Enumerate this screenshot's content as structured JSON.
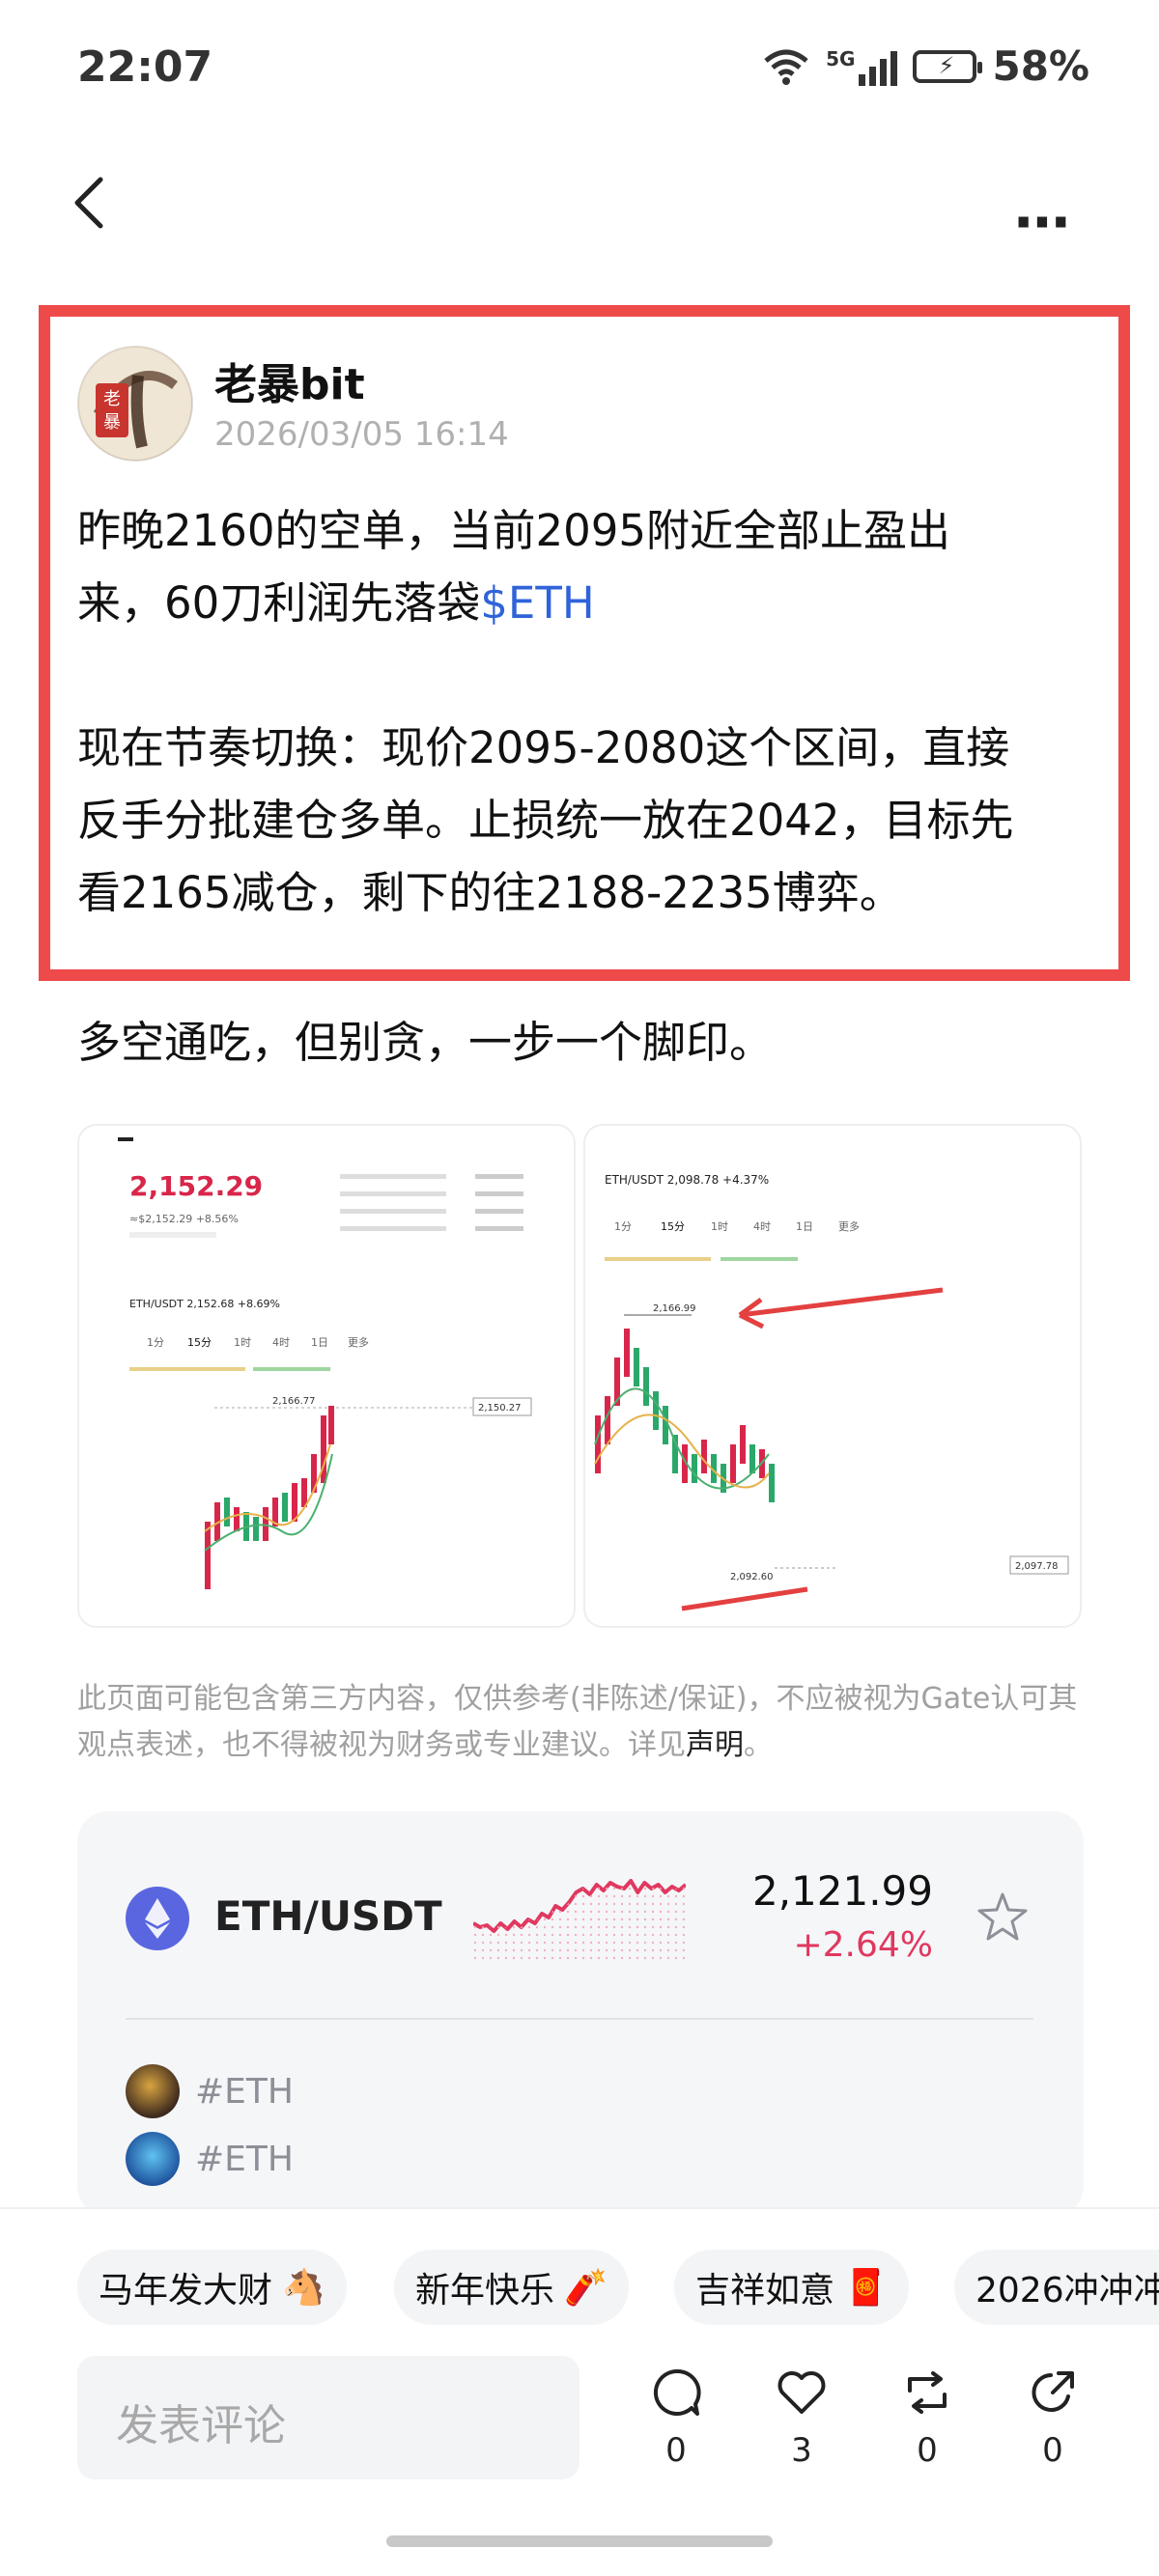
{
  "status": {
    "time": "22:07",
    "network": "5G",
    "battery": "58%"
  },
  "post": {
    "author": "老暴bit",
    "avatar_text": "老暴",
    "date": "2026/03/05 16:14",
    "line1": "昨晚2160的空单，当前2095附近全部止盈出",
    "line2_pre": "来，60刀利润先落袋",
    "line2_tag": "$ETH",
    "line3": "现在节奏切换：现价2095-2080这个区间，直接",
    "line4": "反手分批建仓多单。止损统一放在2042，目标先",
    "line5": "看2165减仓，剩下的往2188-2235博弈。",
    "extra": "多空通吃，但别贪，一步一个脚印。"
  },
  "thumb1": {
    "price": "2,152.29",
    "sub": "≈$2,152.29  +8.56%",
    "pair_line": "ETH/USDT  2,152.68  +8.69%",
    "tabs": [
      "1分",
      "15分",
      "1时",
      "4时",
      "1日",
      "更多"
    ],
    "high_label": "2,166.77",
    "right_label": "2,150.27"
  },
  "thumb2": {
    "pair_line": "ETH/USDT  2,098.78  +4.37%",
    "tabs": [
      "1分",
      "15分",
      "1时",
      "4时",
      "1日",
      "更多"
    ],
    "high_label": "2,166.99",
    "low_label": "2,092.60",
    "right_label": "2,097.78"
  },
  "disclaimer": {
    "text": "此页面可能包含第三方内容，仅供参考(非陈述/保证)，不应被视为Gate认可其观点表述，也不得被视为财务或专业建议。详见",
    "link": "声明",
    "end": "。"
  },
  "market": {
    "pair": "ETH/USDT",
    "price": "2,121.99",
    "change": "+2.64%",
    "tags": [
      "#ETH",
      "#ETH"
    ]
  },
  "chips": [
    {
      "label": "马年发大财",
      "emoji": "🐴"
    },
    {
      "label": "新年快乐",
      "emoji": "🧨"
    },
    {
      "label": "吉祥如意",
      "emoji": "🧧"
    },
    {
      "label": "2026冲冲冲",
      "emoji": ""
    }
  ],
  "comment_placeholder": "发表评论",
  "actions": {
    "comments": "0",
    "likes": "3",
    "reposts": "0",
    "shares": "0"
  },
  "colors": {
    "highlight": "#ee4a4a",
    "link": "#2f63d9",
    "negative": "#e0385f",
    "eth": "#5a66e0"
  }
}
